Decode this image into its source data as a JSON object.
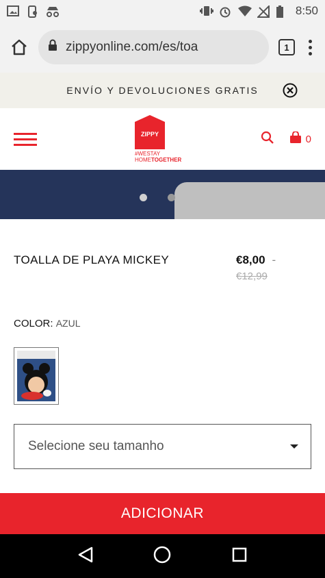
{
  "status_bar": {
    "time": "8:50"
  },
  "browser": {
    "url": "zippyonline.com/es/toa",
    "tab_count": "1"
  },
  "promo": {
    "text": "ENVÍO Y DEVOLUCIONES GRATIS"
  },
  "header": {
    "logo_text": "ZIPPY",
    "tagline_line1": "#WESTAY",
    "tagline_line2_a": "HOME",
    "tagline_line2_b": "TOGETHER",
    "cart_count": "0",
    "accent_color": "#e8242c"
  },
  "product": {
    "name": "TOALLA DE PLAYA MICKEY",
    "price": "€8,00",
    "price_separator": "-",
    "old_price": "€12,99"
  },
  "color": {
    "label": "COLOR:",
    "value": "AZUL"
  },
  "size_select": {
    "placeholder": "Selecione seu tamanho"
  },
  "cta": {
    "label": "ADICIONAR"
  }
}
